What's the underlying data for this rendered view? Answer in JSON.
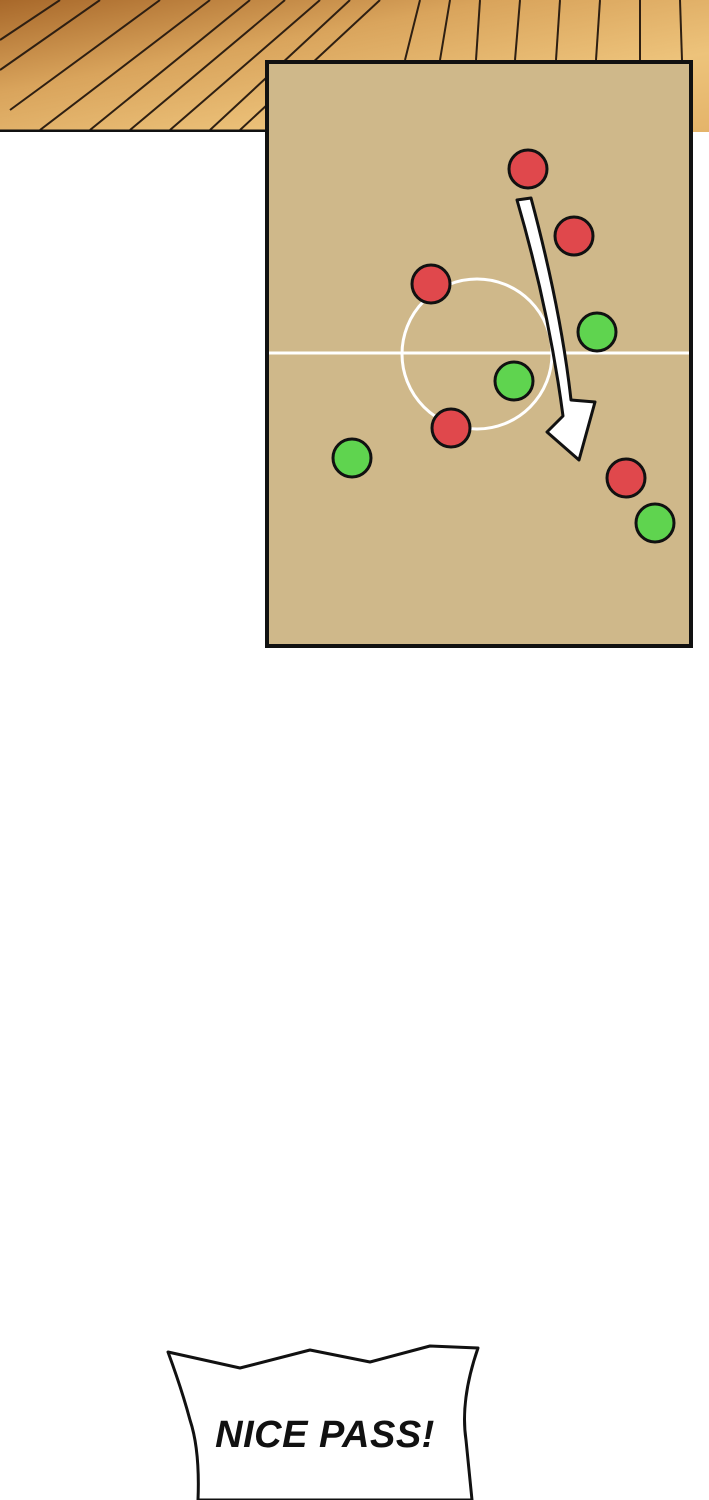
{
  "colors": {
    "floor_light": "#e8b86e",
    "floor_dark": "#b7762e",
    "floor_line": "#3a2a1a",
    "board_fill": "#cfb88a",
    "board_border": "#111111",
    "court_line": "#ffffff",
    "team_red": "#e0484c",
    "team_green": "#5fd44f",
    "arrow_fill": "#ffffff"
  },
  "board": {
    "red_player_count": 5,
    "green_player_count": 4,
    "arrow": "pass-arrow"
  },
  "bubble": {
    "text": "NICE PASS!"
  }
}
